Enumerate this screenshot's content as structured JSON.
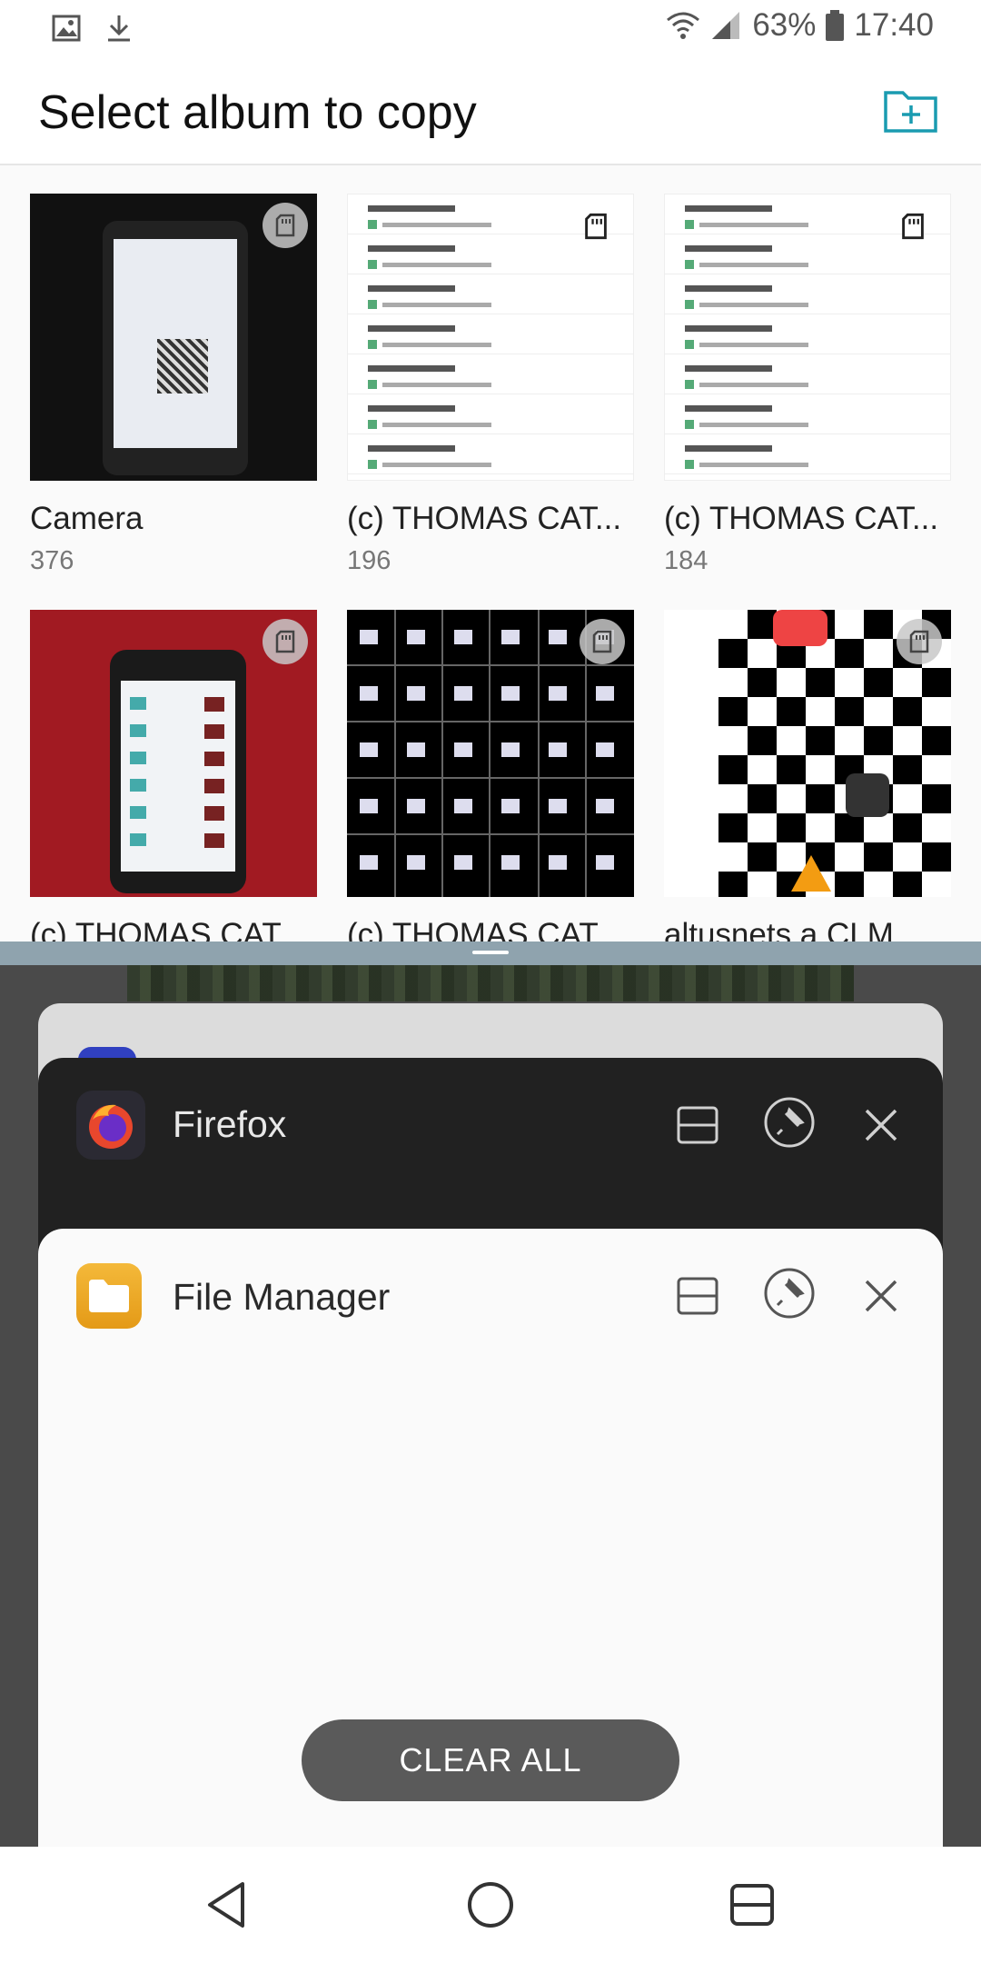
{
  "status_bar": {
    "battery": "63%",
    "time": "17:40"
  },
  "header": {
    "title": "Select album to copy"
  },
  "albums": [
    {
      "name": "Camera",
      "count": "376"
    },
    {
      "name": "(c) THOMAS CAT...",
      "count": "196"
    },
    {
      "name": "(c) THOMAS CAT...",
      "count": "184"
    },
    {
      "name": "(c) THOMAS CAT",
      "count": ""
    },
    {
      "name": "(c) THOMAS CAT",
      "count": ""
    },
    {
      "name": "altusnets a CLM",
      "count": ""
    }
  ],
  "recents": {
    "cards": [
      {
        "app": "Firefox"
      },
      {
        "app": "File Manager"
      }
    ],
    "clear_all": "CLEAR ALL"
  },
  "colors": {
    "accent": "#1a9bb0",
    "divider": "#8fa3ae",
    "recents_bg": "#4a4a4a",
    "firefox_card": "#212121",
    "clear_all_bg": "#5a5a5a"
  }
}
